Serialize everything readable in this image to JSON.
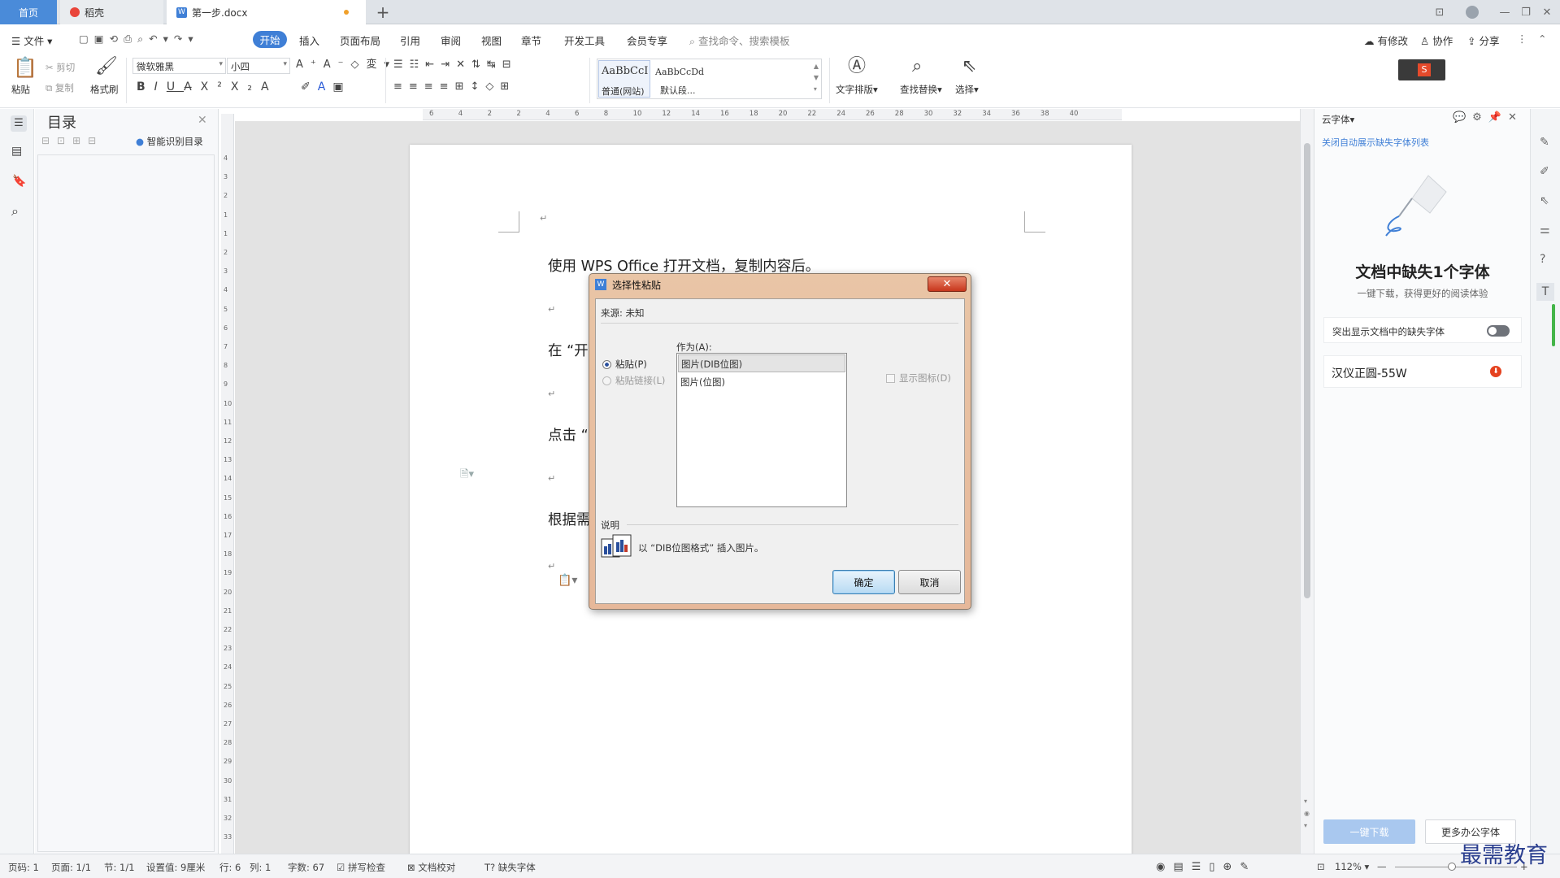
{
  "tabs": {
    "home": "首页",
    "shell": "稻壳",
    "doc": "第一步.docx"
  },
  "menu": {
    "file": "文件",
    "start": "开始",
    "items": [
      "插入",
      "页面布局",
      "引用",
      "审阅",
      "视图",
      "章节",
      "开发工具",
      "会员专享"
    ],
    "search": "查找命令、搜索模板",
    "modified": "有修改",
    "collab": "协作",
    "share": "分享"
  },
  "ribbon": {
    "paste": "粘贴",
    "cut": "剪切",
    "copy": "复制",
    "format_painter": "格式刷",
    "font": "微软雅黑",
    "size": "小四",
    "style_normal_preview": "AaBbCcI",
    "style_normal": "普通(网站)",
    "style_default_preview": "AaBbCcDd",
    "style_default": "默认段...",
    "text_layout": "文字排版",
    "find_replace": "查找替换",
    "select": "选择"
  },
  "toc": {
    "title": "目录",
    "smart": "智能识别目录"
  },
  "ruler": {
    "h_ticks": [
      "6",
      "4",
      "2",
      "2",
      "4",
      "6",
      "8",
      "10",
      "12",
      "14",
      "16",
      "18",
      "20",
      "22",
      "24",
      "26",
      "28",
      "30",
      "32",
      "34",
      "36",
      "38",
      "40"
    ],
    "v_ticks": [
      "4",
      "3",
      "2",
      "1",
      "1",
      "2",
      "3",
      "4",
      "5",
      "6",
      "7",
      "8",
      "9",
      "10",
      "11",
      "12",
      "13",
      "14",
      "15",
      "16",
      "17",
      "18",
      "19",
      "20",
      "21",
      "22",
      "23",
      "24",
      "25",
      "26",
      "27",
      "28",
      "29",
      "30",
      "31",
      "32",
      "33"
    ]
  },
  "document": {
    "lines": [
      "使用 WPS Office 打开文档，复制内容后。",
      "在 “开",
      "点击 “",
      "根据需"
    ]
  },
  "dialog": {
    "title": "选择性粘贴",
    "source_label": "来源: 未知",
    "as_label": "作为(A):",
    "radio_paste": "粘贴(P)",
    "radio_link": "粘贴链接(L)",
    "options": [
      "图片(DIB位图)",
      "图片(位图)"
    ],
    "show_icon": "显示图标(D)",
    "desc_label": "说明",
    "desc_text": "以 “DIB位图格式” 插入图片。",
    "ok": "确定",
    "cancel": "取消"
  },
  "right_panel": {
    "header": "云字体",
    "close_auto": "关闭自动展示缺失字体列表",
    "missing_title": "文档中缺失1个字体",
    "missing_sub": "一键下载，获得更好的阅读体验",
    "highlight": "突出显示文档中的缺失字体",
    "font_name": "汉仪正圆-55W",
    "download_btn": "一键下载",
    "more_btn": "更多办公字体"
  },
  "status": {
    "page": "页码: 1",
    "pages": "页面: 1/1",
    "section": "节: 1/1",
    "setting": "设置值: 9厘米",
    "row": "行: 6",
    "col": "列: 1",
    "words": "字数: 67",
    "spell": "拼写检查",
    "proof": "文档校对",
    "missing_font": "缺失字体",
    "zoom": "112%"
  },
  "watermark": "最需教育",
  "colors": {
    "accent": "#3f7fd6",
    "tab_home": "#4a8bd9",
    "dialog_frame": "#e6b89a",
    "close_red": "#c7361c"
  }
}
